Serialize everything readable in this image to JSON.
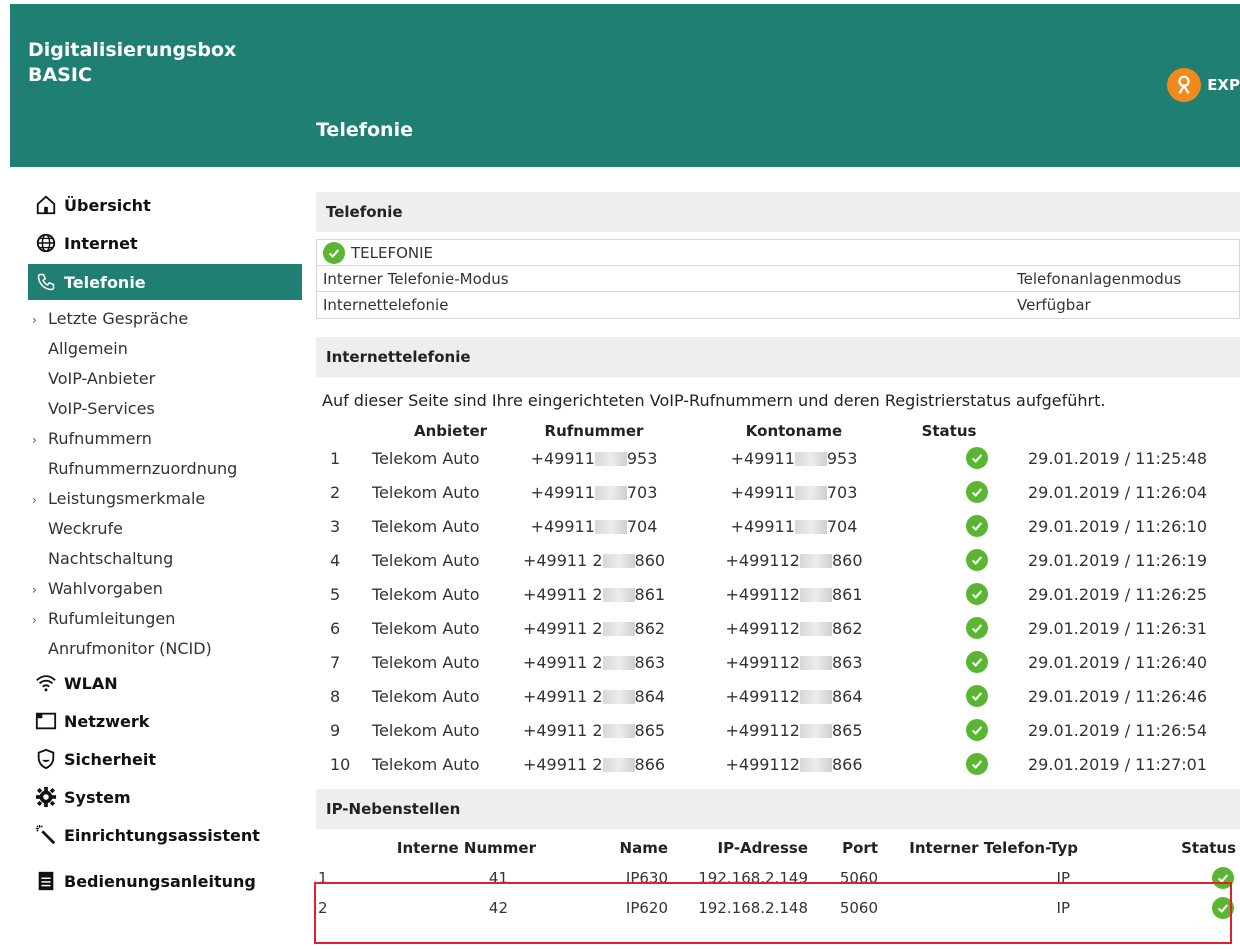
{
  "header": {
    "brand_line1": "Digitalisierungsbox",
    "brand_line2": "BASIC",
    "page_title": "Telefonie",
    "expert_label": "EXP"
  },
  "colors": {
    "brand": "#1f7f73",
    "accent": "#f08a1c",
    "ok": "#5ab532",
    "highlight": "#e0202a"
  },
  "sidebar": {
    "main_items": [
      {
        "label": "Übersicht",
        "icon": "home-icon"
      },
      {
        "label": "Internet",
        "icon": "globe-icon"
      },
      {
        "label": "Telefonie",
        "icon": "phone-icon",
        "active": true
      }
    ],
    "sub_items": [
      {
        "label": "Letzte Gespräche",
        "group": true
      },
      {
        "label": "Allgemein"
      },
      {
        "label": "VoIP-Anbieter"
      },
      {
        "label": "VoIP-Services"
      },
      {
        "label": "Rufnummern",
        "group": true
      },
      {
        "label": "Rufnummernzuordnung"
      },
      {
        "label": "Leistungsmerkmale",
        "group": true
      },
      {
        "label": "Weckrufe"
      },
      {
        "label": "Nachtschaltung"
      },
      {
        "label": "Wahlvorgaben",
        "group": true
      },
      {
        "label": "Rufumleitungen",
        "group": true
      },
      {
        "label": "Anrufmonitor (NCID)"
      }
    ],
    "lower_items": [
      {
        "label": "WLAN",
        "icon": "wifi-icon"
      },
      {
        "label": "Netzwerk",
        "icon": "network-icon"
      },
      {
        "label": "Sicherheit",
        "icon": "shield-icon"
      },
      {
        "label": "System",
        "icon": "gear-icon"
      },
      {
        "label": "Einrichtungsassistent",
        "icon": "wand-icon"
      },
      {
        "label": "Bedienungsanleitung",
        "icon": "manual-icon"
      }
    ]
  },
  "telefonie": {
    "heading": "Telefonie",
    "status_label": "TELEFONIE",
    "rows": [
      {
        "label": "Interner Telefonie-Modus",
        "value": "Telefonanlagenmodus"
      },
      {
        "label": "Internettelefonie",
        "value": "Verfügbar"
      }
    ]
  },
  "internettelefonie": {
    "heading": "Internettelefonie",
    "description": "Auf dieser Seite sind Ihre eingerichteten VoIP-Rufnummern und deren Registrierstatus aufgeführt.",
    "columns": [
      "Anbieter",
      "Rufnummer",
      "Kontoname",
      "Status"
    ],
    "rows": [
      {
        "n": "1",
        "anbieter": "Telekom Auto",
        "num_pre": "+49911",
        "num_suf": "953",
        "konto_pre": "+49911",
        "konto_suf": "953",
        "time": "29.01.2019 / 11:25:48"
      },
      {
        "n": "2",
        "anbieter": "Telekom Auto",
        "num_pre": "+49911",
        "num_suf": "703",
        "konto_pre": "+49911",
        "konto_suf": "703",
        "time": "29.01.2019 / 11:26:04"
      },
      {
        "n": "3",
        "anbieter": "Telekom Auto",
        "num_pre": "+49911",
        "num_suf": "704",
        "konto_pre": "+49911",
        "konto_suf": "704",
        "time": "29.01.2019 / 11:26:10"
      },
      {
        "n": "4",
        "anbieter": "Telekom Auto",
        "num_pre": "+49911 2",
        "num_suf": "860",
        "konto_pre": "+499112",
        "konto_suf": "860",
        "time": "29.01.2019 / 11:26:19"
      },
      {
        "n": "5",
        "anbieter": "Telekom Auto",
        "num_pre": "+49911 2",
        "num_suf": "861",
        "konto_pre": "+499112",
        "konto_suf": "861",
        "time": "29.01.2019 / 11:26:25"
      },
      {
        "n": "6",
        "anbieter": "Telekom Auto",
        "num_pre": "+49911 2",
        "num_suf": "862",
        "konto_pre": "+499112",
        "konto_suf": "862",
        "time": "29.01.2019 / 11:26:31"
      },
      {
        "n": "7",
        "anbieter": "Telekom Auto",
        "num_pre": "+49911 2",
        "num_suf": "863",
        "konto_pre": "+499112",
        "konto_suf": "863",
        "time": "29.01.2019 / 11:26:40"
      },
      {
        "n": "8",
        "anbieter": "Telekom Auto",
        "num_pre": "+49911 2",
        "num_suf": "864",
        "konto_pre": "+499112",
        "konto_suf": "864",
        "time": "29.01.2019 / 11:26:46"
      },
      {
        "n": "9",
        "anbieter": "Telekom Auto",
        "num_pre": "+49911 2",
        "num_suf": "865",
        "konto_pre": "+499112",
        "konto_suf": "865",
        "time": "29.01.2019 / 11:26:54"
      },
      {
        "n": "10",
        "anbieter": "Telekom Auto",
        "num_pre": "+49911 2",
        "num_suf": "866",
        "konto_pre": "+499112",
        "konto_suf": "866",
        "time": "29.01.2019 / 11:27:01"
      }
    ]
  },
  "ip_nebenstellen": {
    "heading": "IP-Nebenstellen",
    "columns": [
      "Interne Nummer",
      "Name",
      "IP-Adresse",
      "Port",
      "Interner Telefon-Typ",
      "Status"
    ],
    "rows": [
      {
        "n": "1",
        "nummer": "41",
        "name": "IP630",
        "ip": "192.168.2.149",
        "port": "5060",
        "typ": "IP"
      },
      {
        "n": "2",
        "nummer": "42",
        "name": "IP620",
        "ip": "192.168.2.148",
        "port": "5060",
        "typ": "IP"
      }
    ]
  }
}
